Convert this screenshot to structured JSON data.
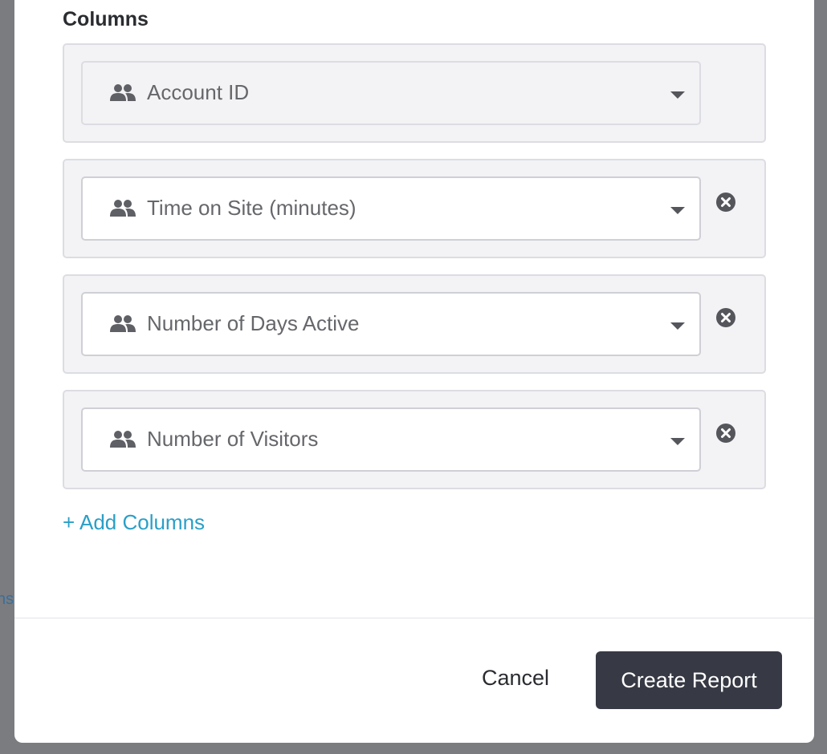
{
  "backdrop": {
    "partial_text": "ns"
  },
  "section": {
    "title": "Columns"
  },
  "columns": [
    {
      "label": "Account ID",
      "icon": "people-icon",
      "removable": false
    },
    {
      "label": "Time on Site (minutes)",
      "icon": "people-icon",
      "removable": true
    },
    {
      "label": "Number of Days Active",
      "icon": "people-icon",
      "removable": true
    },
    {
      "label": "Number of Visitors",
      "icon": "people-icon",
      "removable": true
    }
  ],
  "add_columns_label": "+ Add Columns",
  "footer": {
    "cancel_label": "Cancel",
    "create_label": "Create Report"
  },
  "colors": {
    "accent_link": "#2a9fc7",
    "primary_button": "#373a44",
    "row_background": "#f3f3f5"
  }
}
